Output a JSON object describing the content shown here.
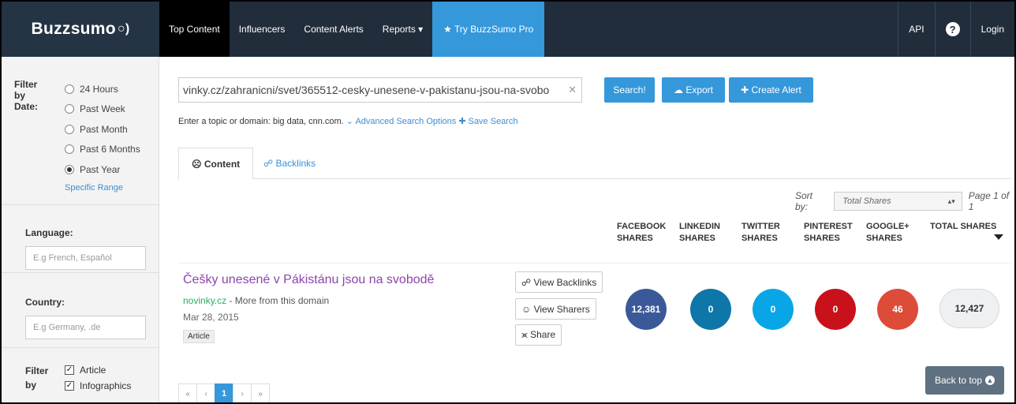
{
  "brand": {
    "name": "Buzzsumo",
    "wave": "○)"
  },
  "nav": {
    "items": [
      {
        "label": "Top Content"
      },
      {
        "label": "Influencers"
      },
      {
        "label": "Content Alerts"
      },
      {
        "label": "Reports ▾"
      },
      {
        "label": "★ Try BuzzSumo Pro"
      }
    ],
    "api": "API",
    "help": "?",
    "login": "Login"
  },
  "sidebar": {
    "date_filter": {
      "label": "Filter by Date:",
      "options": [
        "24 Hours",
        "Past Week",
        "Past Month",
        "Past 6 Months",
        "Past Year"
      ],
      "selected": "Past Year",
      "specific_range": "Specific Range"
    },
    "language": {
      "label": "Language:",
      "placeholder": "E.g French, Español"
    },
    "country": {
      "label": "Country:",
      "placeholder": "E.g Germany, .de"
    },
    "type_filter": {
      "label": "Filter by",
      "options": [
        {
          "label": "Article",
          "checked": true
        },
        {
          "label": "Infographics",
          "checked": true
        }
      ]
    }
  },
  "search": {
    "value": "vinky.cz/zahranicni/svet/365512-cesky-unesene-v-pakistanu-jsou-na-svobo",
    "clear": "✕",
    "search_label": "Search!",
    "export_label": "☁ Export",
    "alert_label": "✚ Create Alert",
    "hint": "Enter a topic or domain: big data, cnn.com.",
    "advanced": "⌄ Advanced Search Options",
    "save": "✚ Save Search"
  },
  "tabs": {
    "content": "☹ Content",
    "backlinks": "☍ Backlinks"
  },
  "sort": {
    "label": "Sort by:",
    "value": "Total Shares",
    "caret": "▴▾",
    "page": "Page 1 of 1"
  },
  "columns": {
    "facebook": [
      "FACEBOOK",
      "SHARES"
    ],
    "linkedin": [
      "LINKEDIN",
      "SHARES"
    ],
    "twitter": [
      "TWITTER",
      "SHARES"
    ],
    "pinterest": [
      "PINTEREST",
      "SHARES"
    ],
    "googleplus": [
      "GOOGLE+",
      "SHARES"
    ],
    "total": "TOTAL SHARES"
  },
  "result": {
    "title": "Češky unesené v Pákistánu jsou na svobodě",
    "domain": "novinky.cz",
    "more": " - More from this domain",
    "date": "Mar 28, 2015",
    "badge": "Article",
    "view_backlinks": "☍ View Backlinks",
    "view_sharers": "☺ View Sharers",
    "share": "⪤ Share",
    "facebook": "12,381",
    "linkedin": "0",
    "twitter": "0",
    "pinterest": "0",
    "googleplus": "46",
    "total": "12,427"
  },
  "colors": {
    "facebook": "#3b5998",
    "linkedin": "#0e76a8",
    "twitter": "#08a6e6",
    "pinterest": "#c8111b",
    "googleplus": "#dd4b39"
  },
  "pager": [
    "«",
    "‹",
    "1",
    "›",
    "»"
  ],
  "back_to_top": "Back to top"
}
